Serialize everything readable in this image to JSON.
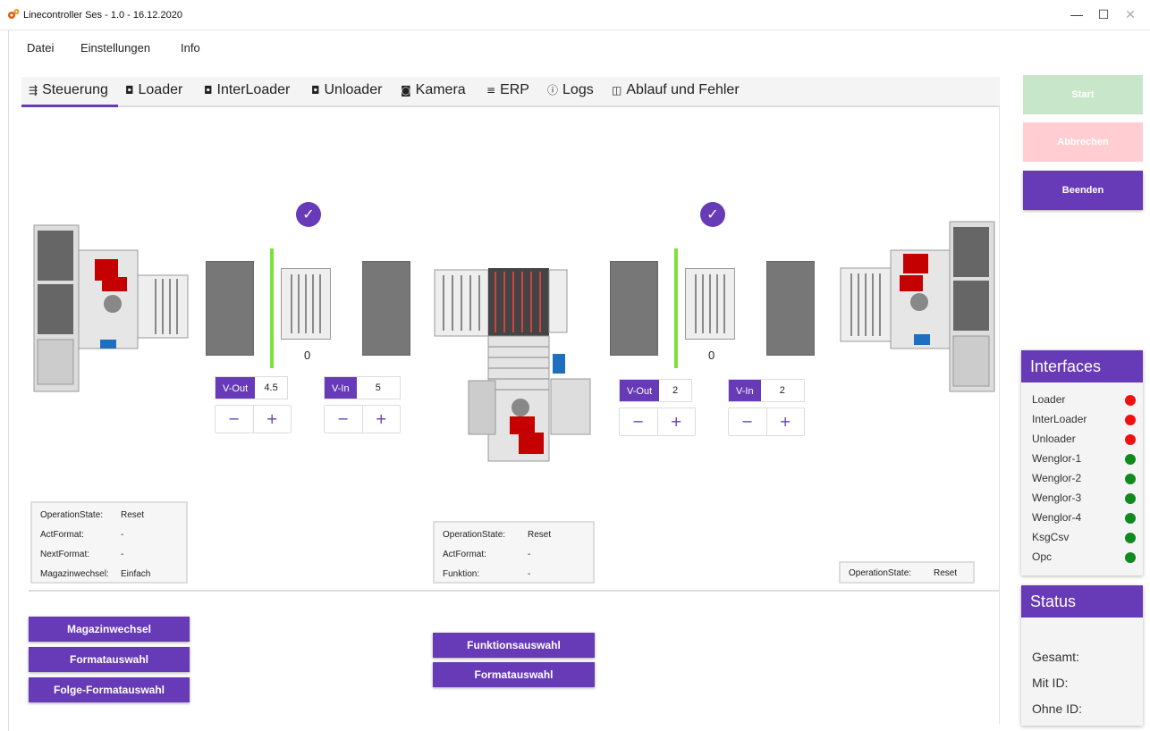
{
  "window": {
    "title": "Linecontroller Ses  -  1.0  -  16.12.2020",
    "minimize": "—",
    "maximize": "☐",
    "close": "✕"
  },
  "menu": [
    "Datei",
    "Einstellungen",
    "Info"
  ],
  "tabs": [
    {
      "label": "Steuerung",
      "icon": "sliders-icon",
      "glyph": "⇶"
    },
    {
      "label": "Loader",
      "icon": "chip-icon",
      "glyph": "◘"
    },
    {
      "label": "InterLoader",
      "icon": "chip-icon",
      "glyph": "◘"
    },
    {
      "label": "Unloader",
      "icon": "chip-icon",
      "glyph": "◘"
    },
    {
      "label": "Kamera",
      "icon": "camera-icon",
      "glyph": "◙"
    },
    {
      "label": "ERP",
      "icon": "database-icon",
      "glyph": "≡"
    },
    {
      "label": "Logs",
      "icon": "info-icon",
      "glyph": "ⓘ"
    },
    {
      "label": "Ablauf und Fehler",
      "icon": "list-icon",
      "glyph": "◫"
    }
  ],
  "active_tab": "Steuerung",
  "buffer_left": {
    "check": "✓",
    "count": "0",
    "vout_label": "V-Out",
    "vout_value": "4.5",
    "vin_label": "V-In",
    "vin_value": "5"
  },
  "buffer_right": {
    "check": "✓",
    "count": "0",
    "vout_label": "V-Out",
    "vout_value": "2",
    "vin_label": "V-In",
    "vin_value": "2"
  },
  "stepper": {
    "minus": "−",
    "plus": "+"
  },
  "loader_state": {
    "rows": [
      {
        "k": "OperationState:",
        "v": "Reset"
      },
      {
        "k": "ActFormat:",
        "v": "-"
      },
      {
        "k": "NextFormat:",
        "v": "-"
      },
      {
        "k": "Magazinwechsel:",
        "v": "Einfach"
      }
    ]
  },
  "interloader_state": {
    "rows": [
      {
        "k": "OperationState:",
        "v": "Reset"
      },
      {
        "k": "ActFormat:",
        "v": "-"
      },
      {
        "k": "Funktion:",
        "v": "-"
      }
    ]
  },
  "unloader_state": {
    "rows": [
      {
        "k": "OperationState:",
        "v": "Reset"
      }
    ]
  },
  "loader_buttons": [
    "Magazinwechsel",
    "Formatauswahl",
    "Folge-Formatauswahl"
  ],
  "interloader_buttons": [
    "Funktionsauswahl",
    "Formatauswahl"
  ],
  "sidebar": {
    "start": "Start",
    "cancel": "Abbrechen",
    "quit": "Beenden",
    "colors": {
      "start": "#c8e6c9",
      "cancel": "#ffcdd2",
      "quit": "#673ab7",
      "accent": "#673ab7",
      "red": "#f01010",
      "green": "#0f8a1c"
    },
    "interfaces_title": "Interfaces",
    "interfaces": [
      {
        "name": "Loader",
        "status": "red"
      },
      {
        "name": "InterLoader",
        "status": "red"
      },
      {
        "name": "Unloader",
        "status": "red"
      },
      {
        "name": "Wenglor-1",
        "status": "green"
      },
      {
        "name": "Wenglor-2",
        "status": "green"
      },
      {
        "name": "Wenglor-3",
        "status": "green"
      },
      {
        "name": "Wenglor-4",
        "status": "green"
      },
      {
        "name": "KsgCsv",
        "status": "green"
      },
      {
        "name": "Opc",
        "status": "green"
      }
    ],
    "status_title": "Status",
    "status": [
      {
        "label": "Gesamt:"
      },
      {
        "label": "Mit ID:"
      },
      {
        "label": "Ohne ID:"
      }
    ]
  }
}
